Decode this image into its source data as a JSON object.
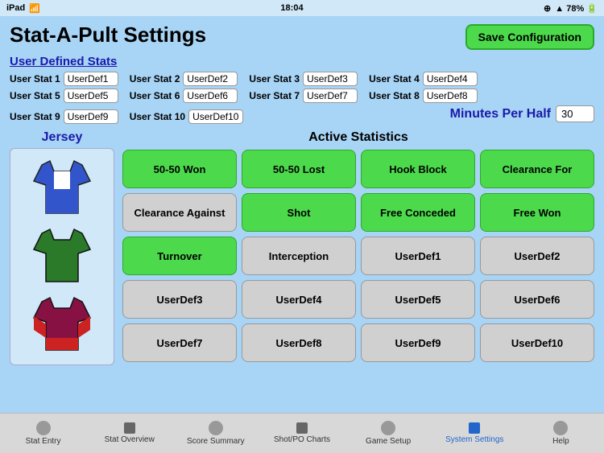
{
  "statusBar": {
    "left": "iPad",
    "time": "18:04",
    "rightIcons": "● ▲ 78%"
  },
  "header": {
    "title": "Stat-A-Pult Settings",
    "saveButton": "Save Configuration"
  },
  "userDefinedStats": {
    "sectionTitle": "User Defined Stats",
    "rows": [
      [
        {
          "label": "User Stat 1",
          "value": "UserDef1"
        },
        {
          "label": "User Stat 2",
          "value": "UserDef2"
        },
        {
          "label": "User Stat 3",
          "value": "UserDef3"
        },
        {
          "label": "User Stat 4",
          "value": "UserDef4"
        }
      ],
      [
        {
          "label": "User Stat 5",
          "value": "UserDef5"
        },
        {
          "label": "User Stat 6",
          "value": "UserDef6"
        },
        {
          "label": "User Stat 7",
          "value": "UserDef7"
        },
        {
          "label": "User Stat 8",
          "value": "UserDef8"
        }
      ],
      [
        {
          "label": "User Stat 9",
          "value": "UserDef9"
        },
        {
          "label": "User Stat 10",
          "value": "UserDef10"
        }
      ]
    ]
  },
  "minutesPerHalf": {
    "label": "Minutes Per Half",
    "value": "30"
  },
  "jerseySection": {
    "title": "Jersey",
    "jerseys": [
      {
        "color1": "#3355cc",
        "color2": "#ffffff",
        "color3": "#3355cc"
      },
      {
        "color1": "#2a7a2a",
        "color2": "#2a7a2a",
        "color3": "#2a7a2a"
      },
      {
        "color1": "#881144",
        "color2": "#881144",
        "color3": "#cc2222"
      }
    ]
  },
  "activeStats": {
    "title": "Active Statistics",
    "buttons": [
      {
        "label": "50-50 Won",
        "style": "green"
      },
      {
        "label": "50-50 Lost",
        "style": "green"
      },
      {
        "label": "Hook Block",
        "style": "green"
      },
      {
        "label": "Clearance For",
        "style": "green"
      },
      {
        "label": "Clearance Against",
        "style": "gray"
      },
      {
        "label": "Shot",
        "style": "green"
      },
      {
        "label": "Free Conceded",
        "style": "green"
      },
      {
        "label": "Free Won",
        "style": "green"
      },
      {
        "label": "Turnover",
        "style": "green"
      },
      {
        "label": "Interception",
        "style": "gray"
      },
      {
        "label": "UserDef1",
        "style": "gray"
      },
      {
        "label": "UserDef2",
        "style": "gray"
      },
      {
        "label": "UserDef3",
        "style": "gray"
      },
      {
        "label": "UserDef4",
        "style": "gray"
      },
      {
        "label": "UserDef5",
        "style": "gray"
      },
      {
        "label": "UserDef6",
        "style": "gray"
      },
      {
        "label": "UserDef7",
        "style": "gray"
      },
      {
        "label": "UserDef8",
        "style": "gray"
      },
      {
        "label": "UserDef9",
        "style": "gray"
      },
      {
        "label": "UserDef10",
        "style": "gray"
      }
    ]
  },
  "tabBar": {
    "tabs": [
      {
        "label": "Stat Entry",
        "iconType": "circle",
        "active": false
      },
      {
        "label": "Stat Overview",
        "iconType": "square",
        "active": false
      },
      {
        "label": "Score Summary",
        "iconType": "circle",
        "active": false
      },
      {
        "label": "Shot/PO Charts",
        "iconType": "square",
        "active": false
      },
      {
        "label": "Game Setup",
        "iconType": "circle",
        "active": false
      },
      {
        "label": "System Settings",
        "iconType": "active-square",
        "active": true
      },
      {
        "label": "Help",
        "iconType": "circle",
        "active": false
      }
    ]
  }
}
